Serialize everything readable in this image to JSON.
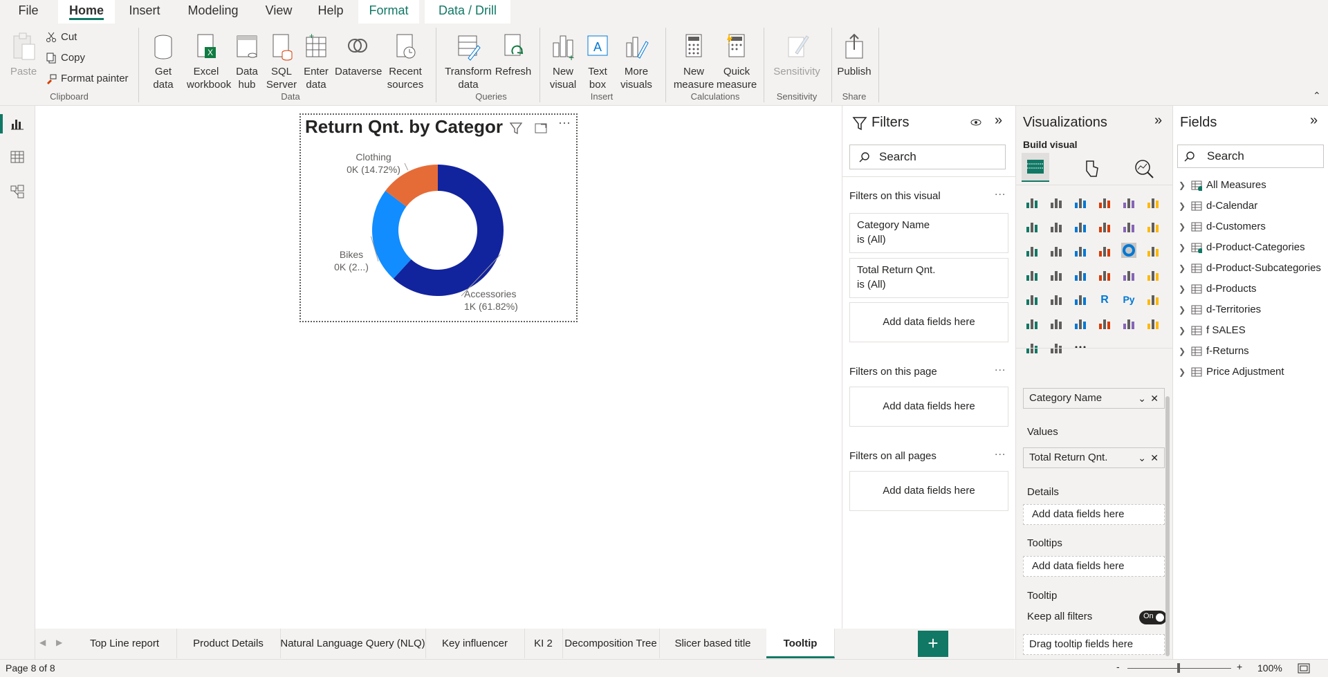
{
  "menu": {
    "tabs": [
      "File",
      "Home",
      "Insert",
      "Modeling",
      "View",
      "Help",
      "Format",
      "Data / Drill"
    ]
  },
  "ribbon": {
    "clipboard": {
      "paste": "Paste",
      "cut": "Cut",
      "copy": "Copy",
      "format_painter": "Format painter",
      "label": "Clipboard"
    },
    "data": {
      "get_data": "Get data",
      "excel": "Excel workbook",
      "data_hub": "Data hub",
      "sql": "SQL Server",
      "enter_data": "Enter data",
      "dataverse": "Dataverse",
      "recent": "Recent sources",
      "label": "Data"
    },
    "queries": {
      "transform": "Transform data",
      "refresh": "Refresh",
      "label": "Queries"
    },
    "insert": {
      "new_visual": "New visual",
      "text_box": "Text box",
      "more_visuals": "More visuals",
      "label": "Insert"
    },
    "calculations": {
      "new_measure": "New measure",
      "quick_measure": "Quick measure",
      "label": "Calculations"
    },
    "sensitivity": {
      "sensitivity": "Sensitivity",
      "label": "Sensitivity"
    },
    "share": {
      "publish": "Publish",
      "label": "Share"
    }
  },
  "visual": {
    "title": "Return Qnt. by Categor",
    "labels": [
      {
        "name": "Clothing",
        "value": "0K (14.72%)"
      },
      {
        "name": "Bikes",
        "value": "0K (2...)"
      },
      {
        "name": "Accessories",
        "value": "1K (61.82%)"
      }
    ]
  },
  "chart_data": {
    "type": "pie",
    "subtype": "donut",
    "title": "Return Qnt. by Categor",
    "categories": [
      "Accessories",
      "Bikes",
      "Clothing"
    ],
    "values": [
      61.82,
      23.46,
      14.72
    ],
    "colors": [
      "#12239e",
      "#118dff",
      "#e66c37"
    ],
    "data_labels": [
      "1K (61.82%)",
      "0K (2...)",
      "0K (14.72%)"
    ]
  },
  "filters": {
    "title": "Filters",
    "search_placeholder": "Search",
    "on_visual": "Filters on this visual",
    "card1_name": "Category Name",
    "card1_state": "is (All)",
    "card2_name": "Total Return Qnt.",
    "card2_state": "is (All)",
    "add_fields": "Add data fields here",
    "on_page": "Filters on this page",
    "on_all": "Filters on all pages",
    "dots": "..."
  },
  "viz": {
    "title": "Visualizations",
    "build_visual": "Build visual",
    "legend_field": "Category Name",
    "values_label": "Values",
    "values_field": "Total Return Qnt.",
    "details_label": "Details",
    "details_placeholder": "Add data fields here",
    "tooltips_label": "Tooltips",
    "tooltips_placeholder": "Add data fields here",
    "tooltip_section": "Tooltip",
    "keep_filters": "Keep all filters",
    "toggle_state": "On",
    "drag_tooltip": "Drag tooltip fields here",
    "more": "..."
  },
  "fields": {
    "title": "Fields",
    "search_placeholder": "Search",
    "items": [
      "All Measures",
      "d-Calendar",
      "d-Customers",
      "d-Product-Categories",
      "d-Product-Subcategories",
      "d-Products",
      "d-Territories",
      "f SALES",
      "f-Returns",
      "Price Adjustment"
    ]
  },
  "pages": {
    "tabs": [
      "Top Line report",
      "Product Details",
      "Natural Language Query (NLQ)",
      "Key influencer",
      "KI 2",
      "Decomposition Tree",
      "Slicer based title",
      "Tooltip"
    ],
    "add": "+"
  },
  "status": {
    "page": "Page 8 of 8",
    "zoom": "100%",
    "minus": "-",
    "plus": "+"
  },
  "colors": {
    "accent": "#117865",
    "ribbon_bg": "#f3f2f1"
  }
}
